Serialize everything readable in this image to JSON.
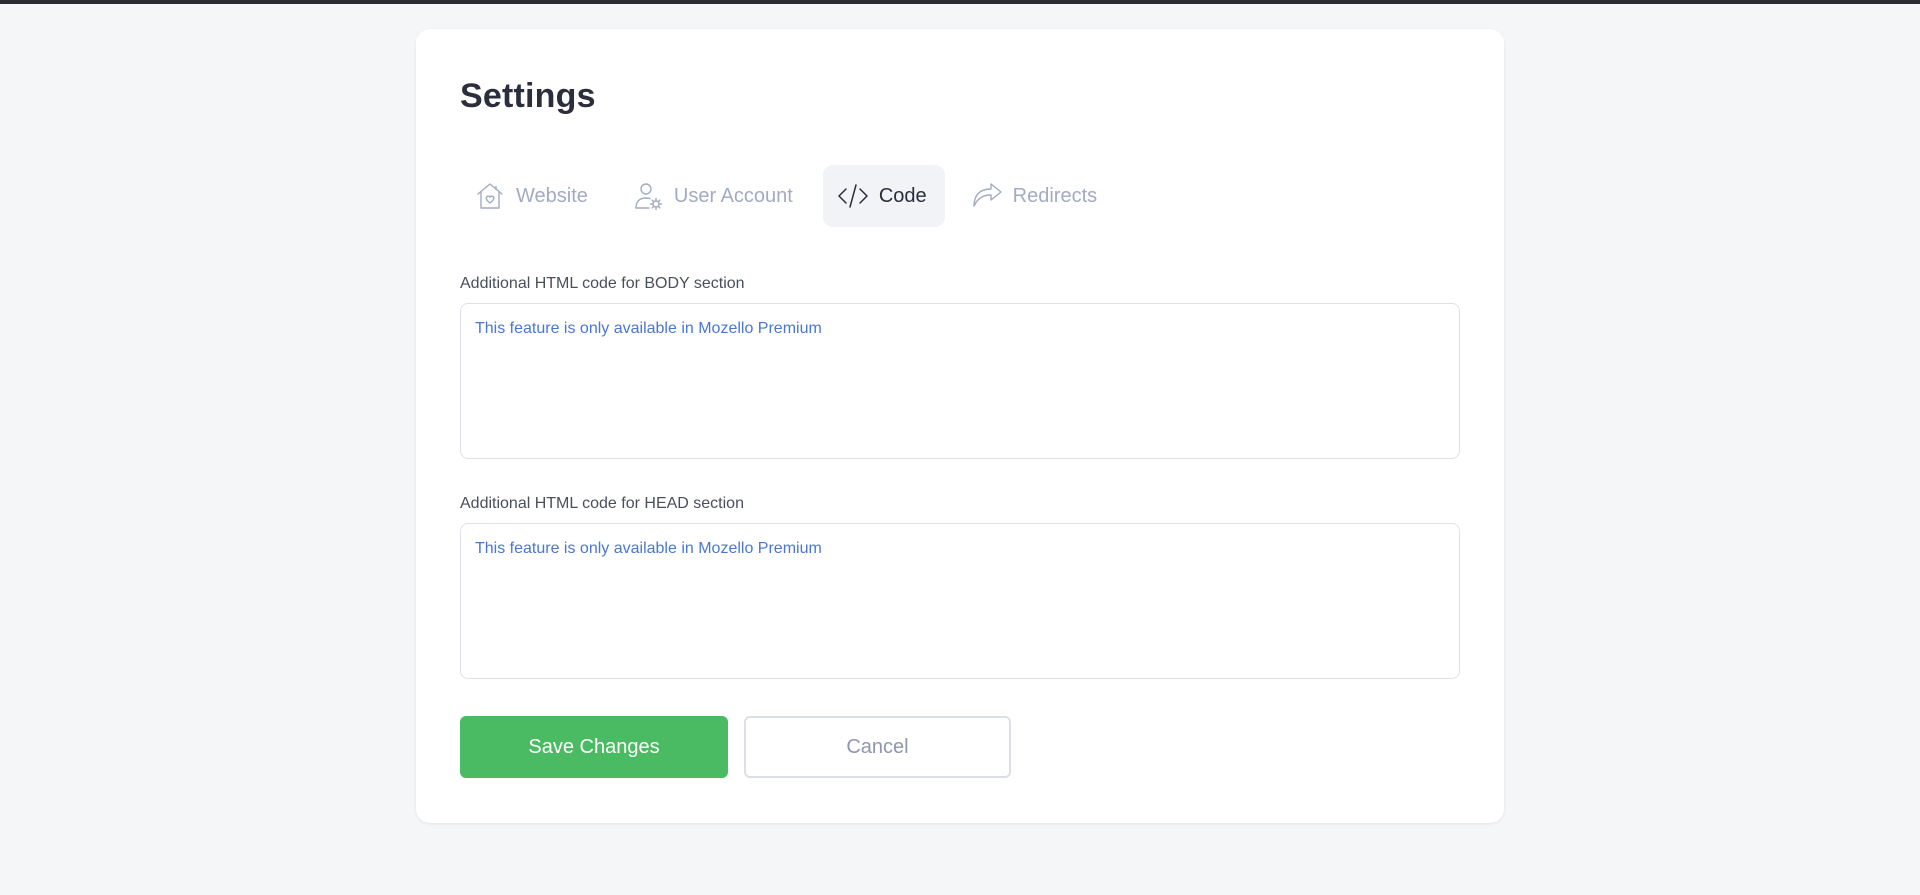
{
  "page": {
    "title": "Settings"
  },
  "tabs": [
    {
      "label": "Website",
      "icon": "house-heart-icon",
      "active": false
    },
    {
      "label": "User Account",
      "icon": "user-gear-icon",
      "active": false
    },
    {
      "label": "Code",
      "icon": "code-icon",
      "active": true
    },
    {
      "label": "Redirects",
      "icon": "redirect-arrow-icon",
      "active": false
    }
  ],
  "fields": {
    "body": {
      "label": "Additional HTML code for BODY section",
      "value": "This feature is only available in Mozello Premium"
    },
    "head": {
      "label": "Additional HTML code for HEAD section",
      "value": "This feature is only available in Mozello Premium"
    }
  },
  "actions": {
    "save_label": "Save Changes",
    "cancel_label": "Cancel"
  },
  "colors": {
    "accent_green": "#4bbb63",
    "link_blue": "#4a77d4",
    "inactive_tab": "#a3abc3",
    "active_tab_bg": "#f1f3f6"
  }
}
